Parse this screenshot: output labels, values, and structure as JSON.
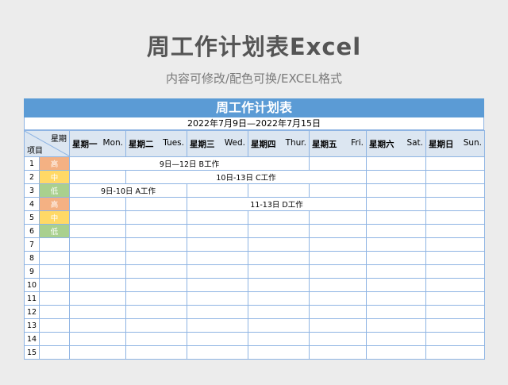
{
  "page": {
    "title": "周工作计划表Excel",
    "subtitle": "内容可修改/配色可换/EXCEL格式"
  },
  "sheet": {
    "title": "周工作计划表",
    "date_range": "2022年7月9日—2022年7月15日",
    "corner_top": "星期",
    "corner_bottom": "项目",
    "days": [
      {
        "cn": "星期一",
        "en": "Mon."
      },
      {
        "cn": "星期二",
        "en": "Tues."
      },
      {
        "cn": "星期三",
        "en": "Wed."
      },
      {
        "cn": "星期四",
        "en": "Thur."
      },
      {
        "cn": "星期五",
        "en": "Fri."
      },
      {
        "cn": "星期六",
        "en": "Sat."
      },
      {
        "cn": "星期日",
        "en": "Sun."
      }
    ],
    "priority_colors": {
      "高": "#f4b183",
      "中": "#ffd966",
      "低": "#a9d08e"
    },
    "rows": [
      {
        "num": "1",
        "priority": "高",
        "task": "9日—12日  B工作"
      },
      {
        "num": "2",
        "priority": "中",
        "task": "10日-13日  C工作"
      },
      {
        "num": "3",
        "priority": "低",
        "task": "9日-10日  A工作"
      },
      {
        "num": "4",
        "priority": "高",
        "task": "11-13日  D工作"
      },
      {
        "num": "5",
        "priority": "中",
        "task": ""
      },
      {
        "num": "6",
        "priority": "低",
        "task": ""
      },
      {
        "num": "7",
        "priority": "",
        "task": ""
      },
      {
        "num": "8",
        "priority": "",
        "task": ""
      },
      {
        "num": "9",
        "priority": "",
        "task": ""
      },
      {
        "num": "10",
        "priority": "",
        "task": ""
      },
      {
        "num": "11",
        "priority": "",
        "task": ""
      },
      {
        "num": "12",
        "priority": "",
        "task": ""
      },
      {
        "num": "13",
        "priority": "",
        "task": ""
      },
      {
        "num": "14",
        "priority": "",
        "task": ""
      },
      {
        "num": "15",
        "priority": "",
        "task": ""
      }
    ]
  }
}
